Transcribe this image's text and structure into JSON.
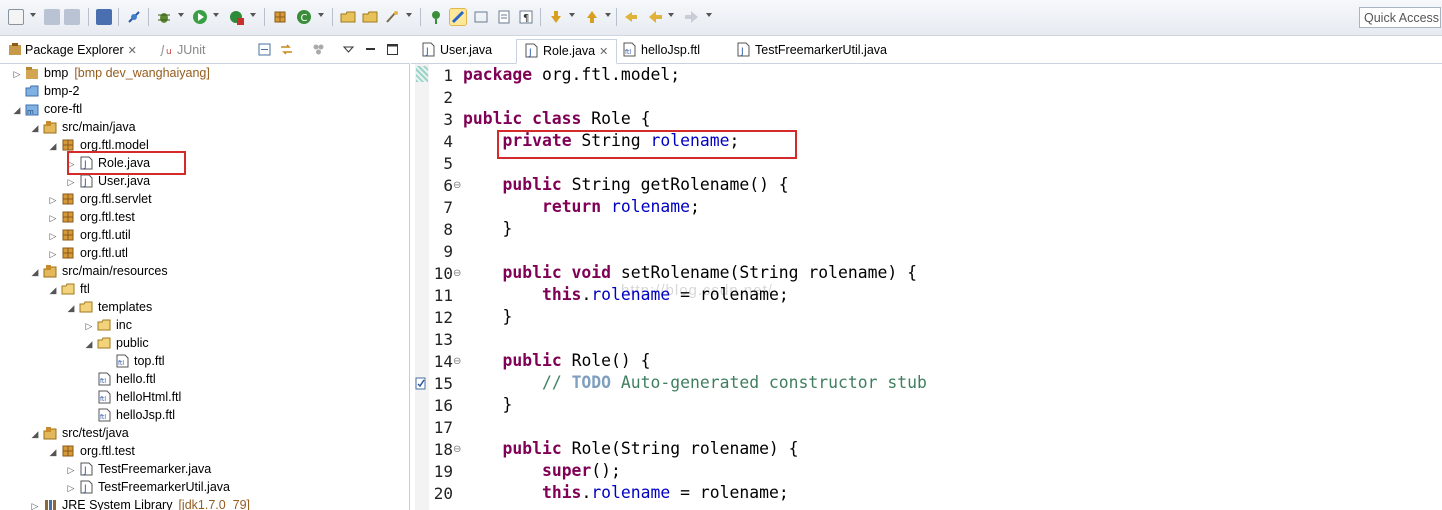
{
  "toolbar": {
    "quick_access": "Quick Access"
  },
  "left_view": {
    "tab_package_explorer": "Package Explorer",
    "tab_junit": "JUnit",
    "tree": [
      {
        "label": "bmp",
        "extra": "[bmp dev_wanghaiyang]",
        "icon": "project-icon",
        "twisty": "▷"
      },
      {
        "label": "bmp-2",
        "icon": "folder-icon",
        "twisty": ""
      },
      {
        "label": "core-ftl",
        "icon": "project-icon",
        "twisty": "◢"
      },
      {
        "label": "src/main/java",
        "icon": "source-folder-icon",
        "twisty": "◢"
      },
      {
        "label": "org.ftl.model",
        "icon": "package-icon",
        "twisty": "◢"
      },
      {
        "label": "Role.java",
        "icon": "java-file-icon",
        "twisty": "▷"
      },
      {
        "label": "User.java",
        "icon": "java-file-icon",
        "twisty": "▷"
      },
      {
        "label": "org.ftl.servlet",
        "icon": "package-icon",
        "twisty": "▷"
      },
      {
        "label": "org.ftl.test",
        "icon": "package-icon",
        "twisty": "▷"
      },
      {
        "label": "org.ftl.util",
        "icon": "package-icon",
        "twisty": "▷"
      },
      {
        "label": "org.ftl.utl",
        "icon": "package-icon",
        "twisty": "▷"
      },
      {
        "label": "src/main/resources",
        "icon": "source-folder-icon",
        "twisty": "◢"
      },
      {
        "label": "ftl",
        "icon": "folder-icon",
        "twisty": "◢"
      },
      {
        "label": "templates",
        "icon": "folder-icon",
        "twisty": "◢"
      },
      {
        "label": "inc",
        "icon": "folder-icon",
        "twisty": "▷"
      },
      {
        "label": "public",
        "icon": "folder-icon",
        "twisty": "◢"
      },
      {
        "label": "top.ftl",
        "icon": "ftl-file-icon",
        "twisty": ""
      },
      {
        "label": "hello.ftl",
        "icon": "ftl-file-icon",
        "twisty": ""
      },
      {
        "label": "helloHtml.ftl",
        "icon": "ftl-file-icon",
        "twisty": ""
      },
      {
        "label": "helloJsp.ftl",
        "icon": "ftl-file-icon",
        "twisty": ""
      },
      {
        "label": "src/test/java",
        "icon": "source-folder-icon",
        "twisty": "◢"
      },
      {
        "label": "org.ftl.test",
        "icon": "package-icon",
        "twisty": "◢"
      },
      {
        "label": "TestFreemarker.java",
        "icon": "java-file-icon",
        "twisty": "▷"
      },
      {
        "label": "TestFreemarkerUtil.java",
        "icon": "java-file-icon",
        "twisty": "▷"
      },
      {
        "label": "JRE System Library",
        "extra": "[jdk1.7.0_79]",
        "icon": "library-icon",
        "twisty": "▷"
      }
    ]
  },
  "editor": {
    "tabs": [
      {
        "label": "User.java",
        "icon": "java-file-icon"
      },
      {
        "label": "Role.java",
        "icon": "java-file-icon"
      },
      {
        "label": "helloJsp.ftl",
        "icon": "ftl-file-icon"
      },
      {
        "label": "TestFreemarkerUtil.java",
        "icon": "java-file-icon"
      }
    ],
    "line_numbers": [
      "1",
      "2",
      "3",
      "4",
      "5",
      "6",
      "7",
      "8",
      "9",
      "10",
      "11",
      "12",
      "13",
      "14",
      "15",
      "16",
      "17",
      "18",
      "19",
      "20"
    ],
    "watermark": "http://blog.csdn.net/",
    "code": {
      "l1_kw": "package",
      "l1_rest": " org.ftl.model;",
      "l3_kw": "public class",
      "l3_rest": " Role {",
      "l4_kw": "private",
      "l4_type": " String ",
      "l4_field": "rolename",
      "l4_end": ";",
      "l6_kw": "public",
      "l6_rest": " String getRolename() {",
      "l7_kw": "return",
      "l7_field": "rolename",
      "l7_end": ";",
      "l8": "}",
      "l10_kw": "public void",
      "l10_rest": " setRolename(String rolename) {",
      "l11_kw": "this",
      "l11_dot": ".",
      "l11_field": "rolename",
      "l11_rest": " = rolename;",
      "l12": "}",
      "l14_kw": "public",
      "l14_rest": " Role() {",
      "l15_cmt1": "// ",
      "l15_todo": "TODO",
      "l15_cmt2": " Auto-generated constructor stub",
      "l16": "}",
      "l18_kw": "public",
      "l18_rest": " Role(String rolename) {",
      "l19_kw": "super",
      "l19_rest": "();",
      "l20_kw": "this",
      "l20_dot": ".",
      "l20_field": "rolename",
      "l20_rest": " = rolename;"
    }
  }
}
